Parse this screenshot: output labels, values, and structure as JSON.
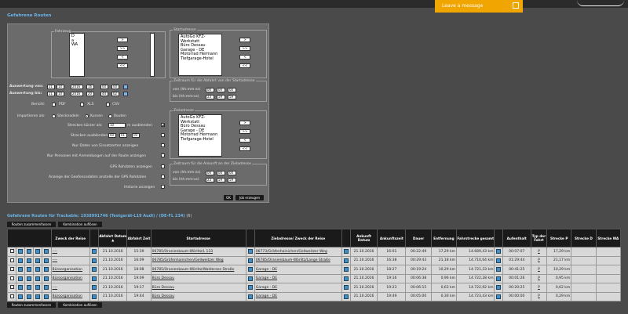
{
  "header": {
    "leave_message": "Leave a message"
  },
  "page_title": "Gefahrene Routen",
  "filter": {
    "fahrzeug_legend": "Fahrzeug",
    "fahrzeug_items": [
      "D",
      "a",
      "WA"
    ],
    "startadresse_legend": "Startadresse",
    "start_items": [
      "AutoGo KFZ-Werkstatt",
      "Büro Dessau",
      "Garage - DE",
      "Motorrad Hermann",
      "Tiefgarage-Hotel"
    ],
    "move_buttons": [
      ">",
      ">>",
      "<",
      "<<"
    ],
    "auswertung_von_label": "Auswertung von:",
    "auswertung_von": [
      "21",
      "10",
      "2016",
      "16",
      "00",
      "00"
    ],
    "auswertung_bis_label": "Auswertung bis:",
    "auswertung_bis": [
      "21",
      "10",
      "2016",
      "20",
      "44",
      "02"
    ],
    "bericht_label": "Bericht:",
    "bericht_opts": [
      "PDF",
      "XLS",
      "CSV"
    ],
    "importieren_label": "Importieren als:",
    "import_opts": [
      "Stecknadeln",
      "Kurven",
      "Routen"
    ],
    "strecken_kuerzer_label": "Strecken kürzer als:",
    "strecken_kuerzer_val": "10",
    "strecken_kuerzer_unit": "m ausblenden",
    "strecken_ausblenden_label": "Strecken ausblenden:",
    "strecken_ausblenden_vals": [
      "00",
      "01",
      "00"
    ],
    "opt_einsatzorten": "Nur Daten von Einsatzorten anzeigen",
    "opt_personen": "Nur Personen mit Anmeldungen auf der Route anzeigen",
    "opt_gps": "GPS Rohdaten anzeigen",
    "opt_geofence": "Anzeige der Geofencedaten anstelle der GPS Rohdaten",
    "opt_historie": "Historie anzeigen",
    "zeitraum_abfahrt_legend": "Zeitraum für die Abfahrt von der Startadresse",
    "zeitraum_ankunft_legend": "Zeitraum für die Ankunft an der Zieladresse",
    "von_label": "von (hh:mm:ss)",
    "bis_label": "bis (hh:mm:ss)",
    "abfahrt_von": [
      "00",
      "00",
      "00"
    ],
    "abfahrt_bis": [
      "23",
      "59",
      "59"
    ],
    "zieladresse_legend": "Zieladresse",
    "ziel_items": [
      "AutoGo KFZ-Werkstatt",
      "Büro Dessau",
      "Garage - DE",
      "Motorrad Hermann",
      "Tiefgarage-Hotel"
    ],
    "ankunft_von": [
      "00",
      "00",
      "00"
    ],
    "ankunft_bis": [
      "23",
      "59",
      "59"
    ],
    "ok_label": "OK",
    "job_label": "Job erzeugen"
  },
  "results": {
    "title": "Gefahrene Routen für Trackable: 1938991746 (Testgerät-L19 Audi) / (DE-FL 234)",
    "count": "(6)",
    "btn_zusammenfassen": "Routen zusammenfassen",
    "btn_kombination": "Kombination auflösen",
    "columns": [
      "Zweck der Reise",
      "Abfahrt Datum ▲",
      "Abfahrt Zeit",
      "Startadresse",
      "Zieladresse/ Zweck der Reise",
      "Ankunft Datum",
      "Ankunftszeit",
      "Dauer",
      "Entfernung",
      "Fahrstrecke gesamt",
      "Aufenthalt",
      "Typ der Fahrt",
      "Strecke P",
      "Strecke D",
      "Strecke WA"
    ],
    "rows": [
      {
        "zweck": "----",
        "datum": "21.10.2016",
        "zeit": "15:39",
        "start": "06785/Oranienbaum-Wörlitz/L 133",
        "ziel": "06773/Gräfenhainichen/Gellweitzer Weg",
        "ank_datum": "21.10.2016",
        "ank_zeit": "16:01",
        "dauer": "00:22:49",
        "entf": "17,29 km",
        "gesamt": "14.689,43 km",
        "aufenthalt": "00:07:07",
        "typ": "P",
        "sp": "17,29 km",
        "sd": "",
        "swa": ""
      },
      {
        "zweck": "----",
        "datum": "21.10.2016",
        "zeit": "16:09",
        "start": "06785/Gräfenhainichen/Gellweitzer Weg",
        "ziel": "06785/Oranienbaum-Wörlitz/Lange Straße",
        "ank_datum": "21.10.2016",
        "ank_zeit": "16:38",
        "dauer": "00:29:43",
        "entf": "21,18 km",
        "gesamt": "14.710,64 km",
        "aufenthalt": "01:29:44",
        "typ": "P",
        "sp": "21,17 km",
        "sd": "",
        "swa": ""
      },
      {
        "zweck": "Büroorganisation",
        "datum": "21.10.2016",
        "zeit": "18:08",
        "start": "06785/Oranienbaum-Wörlitz/Waldersee Straße",
        "ziel": "Garage - DE",
        "ank_datum": "21.10.2016",
        "ank_zeit": "18:27",
        "dauer": "00:19:24",
        "entf": "10,29 km",
        "gesamt": "14.721,33 km",
        "aufenthalt": "00:41:25",
        "typ": "P",
        "sp": "10,29 km",
        "sd": "",
        "swa": ""
      },
      {
        "zweck": "Büroorganisation",
        "datum": "21.10.2016",
        "zeit": "19:09",
        "start": "Büro Dessau",
        "ziel": "Garage - DE",
        "ank_datum": "21.10.2016",
        "ank_zeit": "19:16",
        "dauer": "00:06:38",
        "entf": "0,96 km",
        "gesamt": "14.722,28 km",
        "aufenthalt": "00:01:26",
        "typ": "P",
        "sp": "0,95 km",
        "sd": "",
        "swa": ""
      },
      {
        "zweck": "----",
        "datum": "21.10.2016",
        "zeit": "19:17",
        "start": "Büro Dessau",
        "ziel": "Garage - DE",
        "ank_datum": "21.10.2016",
        "ank_zeit": "19:23",
        "dauer": "00:06:15",
        "entf": "0,63 km",
        "gesamt": "14.722,92 km",
        "aufenthalt": "00:20:25",
        "typ": "P",
        "sp": "0,62 km",
        "sd": "",
        "swa": ""
      },
      {
        "zweck": "Büroorganisation",
        "datum": "21.10.2016",
        "zeit": "19:44",
        "start": "Büro Dessau",
        "ziel": "Garage - DE",
        "ank_datum": "21.10.2016",
        "ank_zeit": "19:49",
        "dauer": "00:05:00",
        "entf": "0,30 km",
        "gesamt": "14.723,43 km",
        "aufenthalt": "00:00:00",
        "typ": "P",
        "sp": "0,29 km",
        "sd": "",
        "swa": ""
      }
    ]
  }
}
